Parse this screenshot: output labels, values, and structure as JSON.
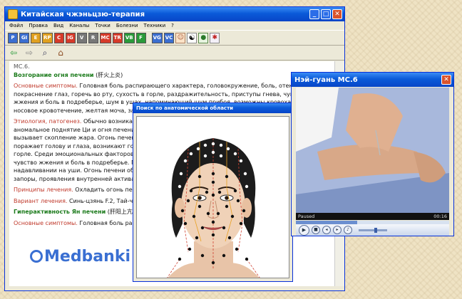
{
  "main_window": {
    "title": "Китайская чжэньцзю-терапия",
    "menu": [
      "Файл",
      "Правка",
      "Вид",
      "Каналы",
      "Точки",
      "Болезни",
      "Техники",
      "?"
    ],
    "toolbar": [
      {
        "label": "P",
        "color": "#3b6ed0"
      },
      {
        "label": "GI",
        "color": "#3b6ed0"
      },
      {
        "label": "E",
        "color": "#e0a020"
      },
      {
        "label": "RP",
        "color": "#e0a020"
      },
      {
        "label": "C",
        "color": "#d63a2a"
      },
      {
        "label": "IG",
        "color": "#d63a2a"
      },
      {
        "label": "V",
        "color": "#777777"
      },
      {
        "label": "R",
        "color": "#777777"
      },
      {
        "label": "MC",
        "color": "#d63a2a"
      },
      {
        "label": "TR",
        "color": "#d63a2a"
      },
      {
        "label": "VB",
        "color": "#2a9a3a"
      },
      {
        "label": "F",
        "color": "#2a9a3a"
      },
      {
        "label": "VG",
        "color": "#3b6ed0"
      },
      {
        "label": "VC",
        "color": "#3b6ed0"
      }
    ],
    "toolbar_icons": [
      "face-icon",
      "yin-yang-icon",
      "turtle-icon",
      "pin-icon"
    ],
    "nav_icons": [
      "back-arrow-icon",
      "forward-arrow-icon",
      "search-icon",
      "home-icon"
    ],
    "content": {
      "top_fragment": "MC.6.",
      "heading1": "Возгорание огня печени",
      "heading1_cn": "(肝火上炎)",
      "symptoms_label": "Основные симптомы.",
      "symptoms_text": "Головная боль распирающего характера, головокружение, боль, отек и покраснение глаз, горечь во рту, сухость в горле, раздражительность, приступы гнева, чувство жжения и боль в подреберье, шум в ушах, напоминающий шум прибоя, возможны кровохарканье и носовое кровотечение, желтая моча, запоры, красный язык с желтым налетом.",
      "etiology_label": "Этиология, патогенез.",
      "etiology_text": "Обычно возникает при подавлении эмоций, вследствие чего происходит аномальное поднятие Ци и огня печени. Неумеренное употребление жирной мясной пищи, что вызывает скопление жара. Огонь печени начинает подниматься вверх, поэтому огонь печени поражает голову и глаза, возникают головная боль распирающего характера, горечь во рту, сухость в горле. Среди эмоциональных факторов — гнев. Огонь печени возникает раздражительность и гнев, чувство жжения и боль в подреберье. Горечь во рту, возникают внезапные приступы шума в ушах, надавливании на уши. Огонь печени обжигает сосуды, возникает носовое кровотечение. Желтая моча, запоры, проявления внутренней активации огня.",
      "principle_label": "Принципы лечения.",
      "principle_text": "Охладить огонь печени.",
      "variant_label": "Вариант лечения.",
      "variant_text": "Синь-цзянь F.2, Тай-чун F.3.",
      "heading2": "Гиперактивность Ян печени",
      "heading2_cn": "(肝阳上亢)",
      "symptoms2_label": "Основные симптомы.",
      "symptoms2_text": "Головная боль распирающего характера, головокружение."
    }
  },
  "watermark": "Medbanki",
  "face_window": {
    "title": "Поиск по анатомической области"
  },
  "video_window": {
    "title": "Нэй-гуань MC.6",
    "status": "Paused",
    "time": "00:16",
    "progress": 0.4
  }
}
